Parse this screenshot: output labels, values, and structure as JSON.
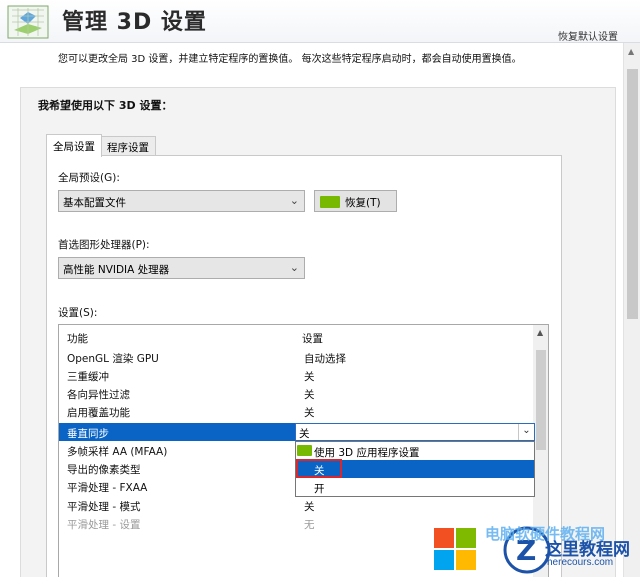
{
  "header": {
    "title": "管理 3D 设置",
    "restore_defaults": "恢复默认设置"
  },
  "description": "您可以更改全局 3D 设置，并建立特定程序的置换值。 每次这些特定程序启动时，都会自动使用置换值。",
  "section_title": "我希望使用以下 3D 设置：",
  "tabs": [
    {
      "label": "全局设置",
      "active": true
    },
    {
      "label": "程序设置",
      "active": false
    }
  ],
  "global_preset": {
    "label": "全局预设(G):",
    "value": "基本配置文件",
    "restore_button": "恢复(T)"
  },
  "preferred_gpu": {
    "label": "首选图形处理器(P):",
    "value": "高性能 NVIDIA 处理器"
  },
  "settings": {
    "label": "设置(S):",
    "col_feature": "功能",
    "col_setting": "设置",
    "rows": [
      {
        "feature": "OpenGL 渲染 GPU",
        "value": "自动选择"
      },
      {
        "feature": "三重缓冲",
        "value": "关"
      },
      {
        "feature": "各向异性过滤",
        "value": "关"
      },
      {
        "feature": "启用覆盖功能",
        "value": "关"
      },
      {
        "feature": "垂直同步",
        "value": "关"
      },
      {
        "feature": "多帧采样 AA (MFAA)",
        "value": ""
      },
      {
        "feature": "导出的像素类型",
        "value": ""
      },
      {
        "feature": "平滑处理 - FXAA",
        "value": ""
      },
      {
        "feature": "平滑处理 - 模式",
        "value": "关"
      },
      {
        "feature": "平滑处理 - 设置",
        "value": "无"
      }
    ],
    "selected_row": 4,
    "dropdown_options": [
      "使用 3D 应用程序设置",
      "关",
      "开"
    ],
    "dropdown_highlighted": 1
  },
  "watermark": {
    "cover_text": "电脑软硬件教程网",
    "brand": "这里教程网",
    "url": "herecours.com"
  },
  "colors": {
    "selection": "#0a64c6",
    "nvidia_green": "#76b900",
    "highlight_box": "#d9272e"
  }
}
